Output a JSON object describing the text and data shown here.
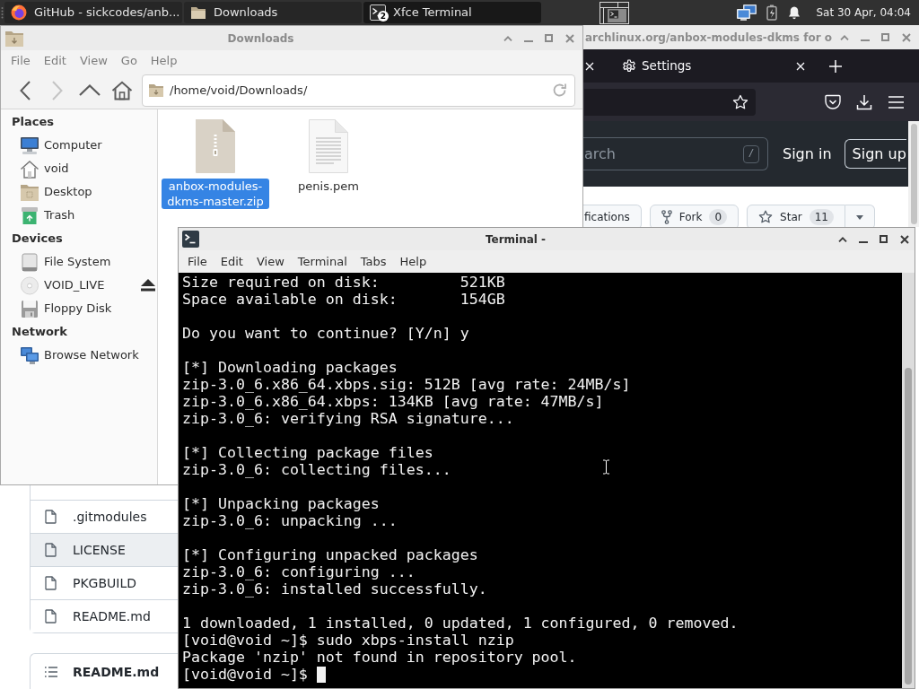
{
  "panel": {
    "tasks": [
      {
        "kind": "browser",
        "title": "GitHub - sickcodes/anb...",
        "selected": false
      },
      {
        "kind": "folder",
        "title": "Downloads",
        "selected": false
      },
      {
        "kind": "terminal",
        "title": "Xfce Terminal",
        "badge": "2",
        "selected": true
      }
    ],
    "clock": "Sat 30 Apr, 04:04"
  },
  "browser": {
    "title": "archlinux.org/anbox-modules-dkms for o",
    "active": false,
    "tabs": [
      {
        "label": "Settings"
      }
    ],
    "header": {
      "search_placeholder": "arch",
      "search_key": "/",
      "sign_in": "Sign in",
      "sign_up": "Sign up"
    },
    "repo_buttons": [
      {
        "kind": "watch",
        "label": "fications"
      },
      {
        "kind": "fork",
        "label": "Fork",
        "count": "0"
      },
      {
        "kind": "star",
        "label": "Star",
        "count": "11"
      }
    ],
    "files": [
      {
        "name": ".gitmodules",
        "highlighted": false
      },
      {
        "name": "LICENSE",
        "highlighted": true
      },
      {
        "name": "PKGBUILD",
        "highlighted": false
      },
      {
        "name": "README.md",
        "highlighted": false
      }
    ],
    "readme_title": "README.md"
  },
  "file_manager": {
    "title": "Downloads",
    "active": false,
    "menu": [
      "File",
      "Edit",
      "View",
      "Go",
      "Help"
    ],
    "nav": [
      {
        "kind": "back",
        "disabled": false
      },
      {
        "kind": "forward",
        "disabled": true
      },
      {
        "kind": "up",
        "disabled": false
      },
      {
        "kind": "home",
        "disabled": false
      }
    ],
    "location": "/home/void/Downloads/",
    "sidebar": [
      {
        "heading": "Places",
        "items": [
          {
            "kind": "computer",
            "label": "Computer",
            "eject": false
          },
          {
            "kind": "home",
            "label": "void",
            "eject": false
          },
          {
            "kind": "desktop",
            "label": "Desktop",
            "eject": false
          },
          {
            "kind": "trash",
            "label": "Trash",
            "eject": false
          }
        ]
      },
      {
        "heading": "Devices",
        "items": [
          {
            "kind": "drive",
            "label": "File System",
            "eject": false
          },
          {
            "kind": "disc",
            "label": "VOID_LIVE",
            "eject": true
          },
          {
            "kind": "floppy",
            "label": "Floppy Disk",
            "eject": false
          }
        ]
      },
      {
        "heading": "Network",
        "items": [
          {
            "kind": "network",
            "label": "Browse Network",
            "eject": false
          }
        ]
      }
    ],
    "files": [
      {
        "kind": "zip",
        "name": "anbox-modules-dkms-master.zip",
        "selected": true
      },
      {
        "kind": "text",
        "name": "penis.pem",
        "selected": false
      }
    ]
  },
  "terminal": {
    "title": "Terminal -",
    "active": true,
    "menu": [
      "File",
      "Edit",
      "View",
      "Terminal",
      "Tabs",
      "Help"
    ],
    "blocks": [
      [
        "Size required on disk:         521KB",
        "Space available on disk:       154GB"
      ],
      [
        "Do you want to continue? [Y/n] y"
      ],
      [
        "[*] Downloading packages",
        "zip-3.0_6.x86_64.xbps.sig: 512B [avg rate: 24MB/s]",
        "zip-3.0_6.x86_64.xbps: 134KB [avg rate: 47MB/s]",
        "zip-3.0_6: verifying RSA signature..."
      ],
      [
        "[*] Collecting package files",
        "zip-3.0_6: collecting files..."
      ],
      [
        "[*] Unpacking packages",
        "zip-3.0_6: unpacking ..."
      ],
      [
        "[*] Configuring unpacked packages",
        "zip-3.0_6: configuring ...",
        "zip-3.0_6: installed successfully."
      ],
      [
        "1 downloaded, 1 installed, 0 updated, 1 configured, 0 removed.",
        "[void@void ~]$ sudo xbps-install nzip",
        "Package 'nzip' not found in repository pool."
      ]
    ],
    "prompt": "[void@void ~]$",
    "cursor": true
  }
}
